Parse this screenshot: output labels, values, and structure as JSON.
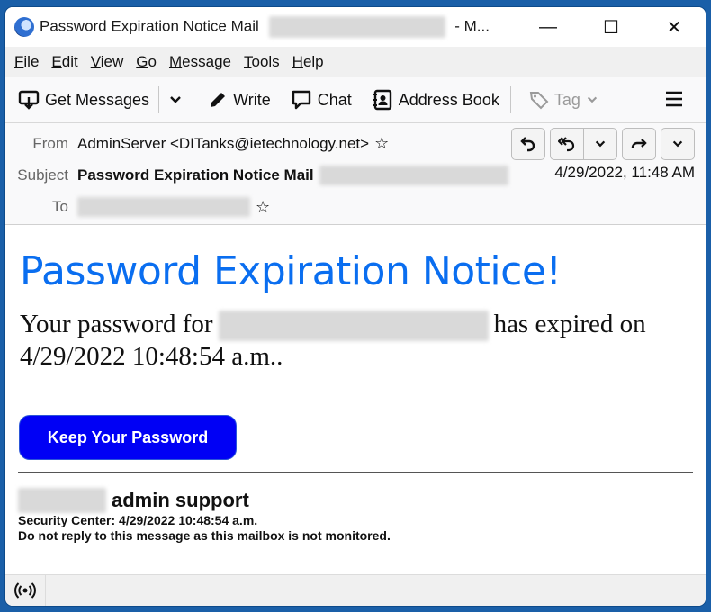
{
  "window": {
    "title_prefix": "Password Expiration Notice Mail",
    "title_suffix": "- M...",
    "controls": {
      "minimize": "—",
      "maximize": "☐",
      "close": "✕"
    }
  },
  "menu": [
    {
      "key": "F",
      "rest": "ile"
    },
    {
      "key": "E",
      "rest": "dit"
    },
    {
      "key": "V",
      "rest": "iew"
    },
    {
      "key": "G",
      "rest": "o"
    },
    {
      "key": "M",
      "rest": "essage"
    },
    {
      "key": "T",
      "rest": "ools"
    },
    {
      "key": "H",
      "rest": "elp"
    }
  ],
  "toolbar": {
    "get_messages": "Get Messages",
    "write": "Write",
    "chat": "Chat",
    "address_book": "Address Book",
    "tag": "Tag"
  },
  "header": {
    "from_label": "From",
    "from_value": "AdminServer <DITanks@ietechnology.net>",
    "subject_label": "Subject",
    "subject_value": "Password Expiration Notice Mail",
    "to_label": "To",
    "date": "4/29/2022, 11:48 AM"
  },
  "email": {
    "heading": "Password Expiration Notice!",
    "para_start": "Your password for",
    "para_end": "has expired on",
    "para_line2": "4/29/2022 10:48:54 a.m..",
    "button_label": "Keep Your Password",
    "signature_title": "admin support",
    "signature_line1": "Security Center: 4/29/2022 10:48:54 a.m.",
    "signature_line2": "Do not reply to this message as this mailbox is not monitored."
  },
  "colors": {
    "heading": "#0a6ef0",
    "button": "#0000f5",
    "frame": "#1a5fa8"
  }
}
